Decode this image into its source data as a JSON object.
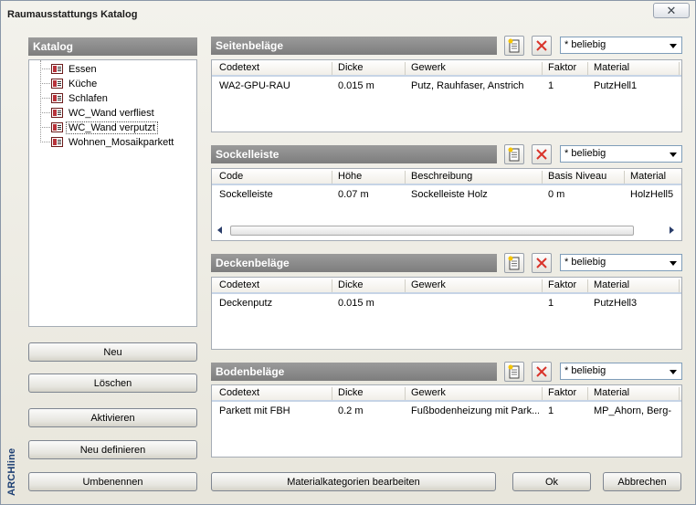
{
  "window": {
    "title": "Raumausstattungs Katalog",
    "close_glyph": "✕"
  },
  "catalog": {
    "header": "Katalog",
    "items": [
      {
        "label": "Essen"
      },
      {
        "label": "Küche"
      },
      {
        "label": "Schlafen"
      },
      {
        "label": "WC_Wand verfliest"
      },
      {
        "label": "WC_Wand verputzt"
      },
      {
        "label": "Wohnen_Mosaikparkett"
      }
    ],
    "selected_index": 4
  },
  "left_buttons": {
    "new": "Neu",
    "delete": "Löschen",
    "activate": "Aktivieren",
    "redefine": "Neu definieren",
    "rename": "Umbenennen"
  },
  "brand": "ARCHline",
  "sections": {
    "wall": {
      "header": "Seitenbeläge",
      "filter": "* beliebig",
      "columns": [
        "Codetext",
        "Dicke",
        "Gewerk",
        "Faktor",
        "Material"
      ],
      "rows": [
        [
          "WA2-GPU-RAU",
          "0.015 m",
          "Putz, Rauhfaser, Anstrich",
          "1",
          "PutzHell1"
        ]
      ]
    },
    "skirting": {
      "header": "Sockelleiste",
      "filter": "* beliebig",
      "columns": [
        "Code",
        "Höhe",
        "Beschreibung",
        "Basis Niveau",
        "Material"
      ],
      "rows": [
        [
          "Sockelleiste",
          "0.07 m",
          "Sockelleiste Holz",
          "0 m",
          "HolzHell5"
        ]
      ]
    },
    "ceiling": {
      "header": "Deckenbeläge",
      "filter": "* beliebig",
      "columns": [
        "Codetext",
        "Dicke",
        "Gewerk",
        "Faktor",
        "Material"
      ],
      "rows": [
        [
          "Deckenputz",
          "0.015 m",
          "",
          "1",
          "PutzHell3"
        ]
      ]
    },
    "floor": {
      "header": "Bodenbeläge",
      "filter": "* beliebig",
      "columns": [
        "Codetext",
        "Dicke",
        "Gewerk",
        "Faktor",
        "Material"
      ],
      "rows": [
        [
          "Parkett mit FBH",
          "0.2 m",
          "Fußbodenheizung mit Park...",
          "1",
          "MP_Ahorn, Berg-"
        ]
      ]
    }
  },
  "bottom_buttons": {
    "edit_material_categories": "Materialkategorien bearbeiten",
    "ok": "Ok",
    "cancel": "Abbrechen"
  },
  "icons": {
    "new": "new-document-icon",
    "delete": "delete-x-icon"
  },
  "colors": {
    "header_bg": "#8a8a8a",
    "delete_red": "#d9342b"
  }
}
